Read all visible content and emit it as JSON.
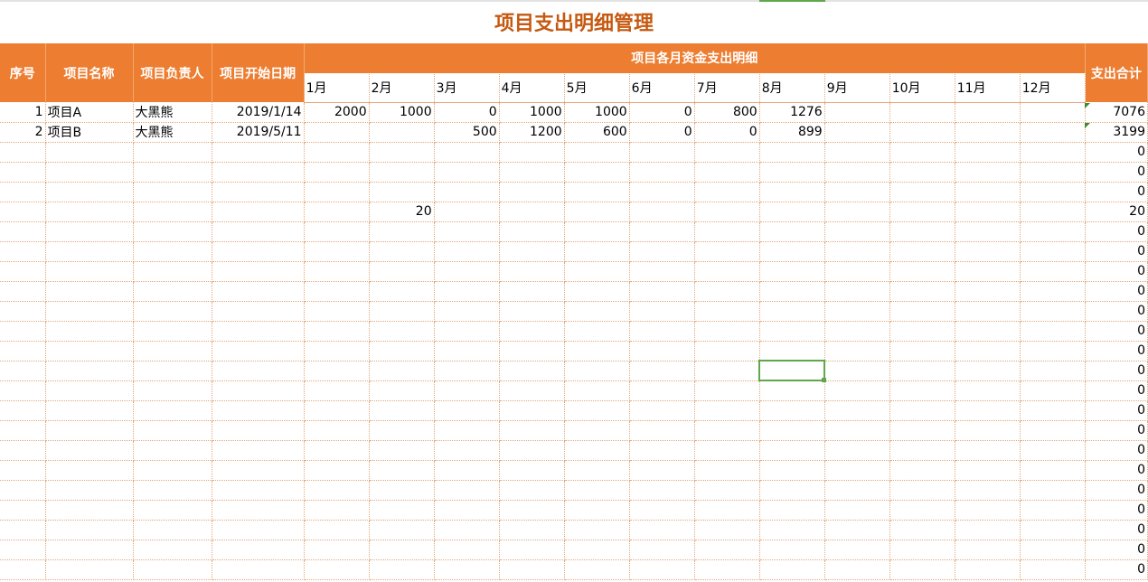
{
  "title": "项目支出明细管理",
  "headers": {
    "seq": "序号",
    "name": "项目名称",
    "owner": "项目负责人",
    "start_date": "项目开始日期",
    "group": "项目各月资金支出明细",
    "total": "支出合计",
    "months": [
      "1月",
      "2月",
      "3月",
      "4月",
      "5月",
      "6月",
      "7月",
      "8月",
      "9月",
      "10月",
      "11月",
      "12月"
    ]
  },
  "rows": [
    {
      "seq": "1",
      "name": "项目A",
      "owner": "大黑熊",
      "date": "2019/1/14",
      "m": [
        "2000",
        "1000",
        "0",
        "1000",
        "1000",
        "0",
        "800",
        "1276",
        "",
        "",
        "",
        ""
      ],
      "total": "7076"
    },
    {
      "seq": "2",
      "name": "项目B",
      "owner": "大黑熊",
      "date": "2019/5/11",
      "m": [
        "",
        "",
        "500",
        "1200",
        "600",
        "0",
        "0",
        "899",
        "",
        "",
        "",
        ""
      ],
      "total": "3199"
    },
    {
      "seq": "",
      "name": "",
      "owner": "",
      "date": "",
      "m": [
        "",
        "",
        "",
        "",
        "",
        "",
        "",
        "",
        "",
        "",
        "",
        ""
      ],
      "total": "0"
    },
    {
      "seq": "",
      "name": "",
      "owner": "",
      "date": "",
      "m": [
        "",
        "",
        "",
        "",
        "",
        "",
        "",
        "",
        "",
        "",
        "",
        ""
      ],
      "total": "0"
    },
    {
      "seq": "",
      "name": "",
      "owner": "",
      "date": "",
      "m": [
        "",
        "",
        "",
        "",
        "",
        "",
        "",
        "",
        "",
        "",
        "",
        ""
      ],
      "total": "0"
    },
    {
      "seq": "",
      "name": "",
      "owner": "",
      "date": "",
      "m": [
        "",
        "20",
        "",
        "",
        "",
        "",
        "",
        "",
        "",
        "",
        "",
        ""
      ],
      "total": "20"
    },
    {
      "seq": "",
      "name": "",
      "owner": "",
      "date": "",
      "m": [
        "",
        "",
        "",
        "",
        "",
        "",
        "",
        "",
        "",
        "",
        "",
        ""
      ],
      "total": "0"
    },
    {
      "seq": "",
      "name": "",
      "owner": "",
      "date": "",
      "m": [
        "",
        "",
        "",
        "",
        "",
        "",
        "",
        "",
        "",
        "",
        "",
        ""
      ],
      "total": "0"
    },
    {
      "seq": "",
      "name": "",
      "owner": "",
      "date": "",
      "m": [
        "",
        "",
        "",
        "",
        "",
        "",
        "",
        "",
        "",
        "",
        "",
        ""
      ],
      "total": "0"
    },
    {
      "seq": "",
      "name": "",
      "owner": "",
      "date": "",
      "m": [
        "",
        "",
        "",
        "",
        "",
        "",
        "",
        "",
        "",
        "",
        "",
        ""
      ],
      "total": "0"
    },
    {
      "seq": "",
      "name": "",
      "owner": "",
      "date": "",
      "m": [
        "",
        "",
        "",
        "",
        "",
        "",
        "",
        "",
        "",
        "",
        "",
        ""
      ],
      "total": "0"
    },
    {
      "seq": "",
      "name": "",
      "owner": "",
      "date": "",
      "m": [
        "",
        "",
        "",
        "",
        "",
        "",
        "",
        "",
        "",
        "",
        "",
        ""
      ],
      "total": "0"
    },
    {
      "seq": "",
      "name": "",
      "owner": "",
      "date": "",
      "m": [
        "",
        "",
        "",
        "",
        "",
        "",
        "",
        "",
        "",
        "",
        "",
        ""
      ],
      "total": "0"
    },
    {
      "seq": "",
      "name": "",
      "owner": "",
      "date": "",
      "m": [
        "",
        "",
        "",
        "",
        "",
        "",
        "",
        "",
        "",
        "",
        "",
        ""
      ],
      "total": "0"
    },
    {
      "seq": "",
      "name": "",
      "owner": "",
      "date": "",
      "m": [
        "",
        "",
        "",
        "",
        "",
        "",
        "",
        "",
        "",
        "",
        "",
        ""
      ],
      "total": "0"
    },
    {
      "seq": "",
      "name": "",
      "owner": "",
      "date": "",
      "m": [
        "",
        "",
        "",
        "",
        "",
        "",
        "",
        "",
        "",
        "",
        "",
        ""
      ],
      "total": "0"
    },
    {
      "seq": "",
      "name": "",
      "owner": "",
      "date": "",
      "m": [
        "",
        "",
        "",
        "",
        "",
        "",
        "",
        "",
        "",
        "",
        "",
        ""
      ],
      "total": "0"
    },
    {
      "seq": "",
      "name": "",
      "owner": "",
      "date": "",
      "m": [
        "",
        "",
        "",
        "",
        "",
        "",
        "",
        "",
        "",
        "",
        "",
        ""
      ],
      "total": "0"
    },
    {
      "seq": "",
      "name": "",
      "owner": "",
      "date": "",
      "m": [
        "",
        "",
        "",
        "",
        "",
        "",
        "",
        "",
        "",
        "",
        "",
        ""
      ],
      "total": "0"
    },
    {
      "seq": "",
      "name": "",
      "owner": "",
      "date": "",
      "m": [
        "",
        "",
        "",
        "",
        "",
        "",
        "",
        "",
        "",
        "",
        "",
        ""
      ],
      "total": "0"
    },
    {
      "seq": "",
      "name": "",
      "owner": "",
      "date": "",
      "m": [
        "",
        "",
        "",
        "",
        "",
        "",
        "",
        "",
        "",
        "",
        "",
        ""
      ],
      "total": "0"
    },
    {
      "seq": "",
      "name": "",
      "owner": "",
      "date": "",
      "m": [
        "",
        "",
        "",
        "",
        "",
        "",
        "",
        "",
        "",
        "",
        "",
        ""
      ],
      "total": "0"
    },
    {
      "seq": "",
      "name": "",
      "owner": "",
      "date": "",
      "m": [
        "",
        "",
        "",
        "",
        "",
        "",
        "",
        "",
        "",
        "",
        "",
        ""
      ],
      "total": "0"
    },
    {
      "seq": "",
      "name": "",
      "owner": "",
      "date": "",
      "m": [
        "",
        "",
        "",
        "",
        "",
        "",
        "",
        "",
        "",
        "",
        "",
        ""
      ],
      "total": "0"
    }
  ],
  "colors": {
    "header_bg": "#ed7d31",
    "title": "#c65911",
    "gridline": "#e3a77b",
    "selection": "#5fa74a"
  }
}
